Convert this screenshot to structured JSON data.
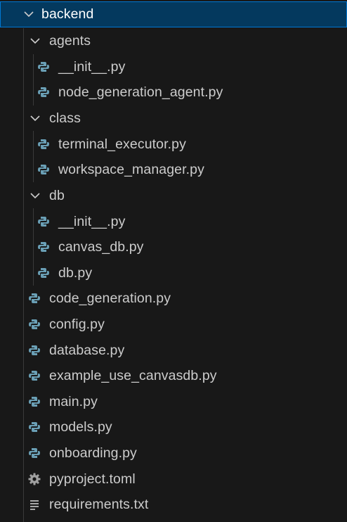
{
  "explorer": {
    "root": {
      "label": "backend",
      "icon": "chevron-down-icon"
    },
    "folder_agents": {
      "label": "agents",
      "children": [
        "__init__.py",
        "node_generation_agent.py"
      ]
    },
    "folder_class": {
      "label": "class",
      "children": [
        "terminal_executor.py",
        "workspace_manager.py"
      ]
    },
    "folder_db": {
      "label": "db",
      "children": [
        "__init__.py",
        "canvas_db.py",
        "db.py"
      ]
    },
    "root_files": [
      "code_generation.py",
      "config.py",
      "database.py",
      "example_use_canvasdb.py",
      "main.py",
      "models.py",
      "onboarding.py",
      "pyproject.toml",
      "requirements.txt"
    ],
    "colors": {
      "background": "#181818",
      "selection": "#04395e",
      "selection_border": "#0078d4",
      "python_icon": "#6a9fb5",
      "text": "#cccccc"
    }
  }
}
